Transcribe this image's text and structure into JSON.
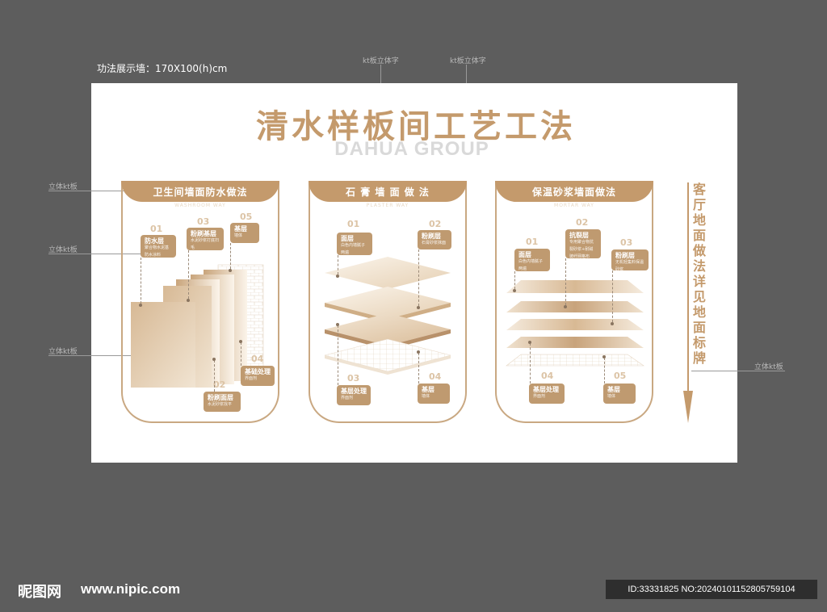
{
  "spec_label": "功法展示墙：170X100(h)cm",
  "callouts": {
    "top_left": "kt板立体字",
    "top_right": "kt板立体字",
    "left_1": "立体kt板",
    "left_2": "立体kt板",
    "left_3": "立体kt板",
    "right_1": "立体kt板"
  },
  "board": {
    "title": "清水样板间工艺工法",
    "brand": "DAHUA GROUP"
  },
  "panels": [
    {
      "title": "卫生间墙面防水做法",
      "subtitle": "WASHROOM WAY",
      "steps": [
        {
          "num": "01",
          "title": "防水层",
          "desc": "聚合物水泥基防水涂料"
        },
        {
          "num": "03",
          "title": "粉刷基层",
          "desc": "水泥砂浆打底扫毛"
        },
        {
          "num": "05",
          "title": "基层",
          "desc": "墙体"
        },
        {
          "num": "04",
          "title": "基础处理",
          "desc": "界面剂"
        },
        {
          "num": "02",
          "title": "粉刷面层",
          "desc": "水泥砂浆找平"
        }
      ]
    },
    {
      "title": "石 膏 墙 面 做 法",
      "subtitle": "PLASTER WAY",
      "steps": [
        {
          "num": "01",
          "title": "面层",
          "desc": "白色内墙腻子两遍"
        },
        {
          "num": "02",
          "title": "粉刷层",
          "desc": "石膏砂浆抹面"
        },
        {
          "num": "03",
          "title": "基层处理",
          "desc": "界面剂"
        },
        {
          "num": "04",
          "title": "基层",
          "desc": "墙体"
        }
      ]
    },
    {
      "title": "保温砂浆墙面做法",
      "subtitle": "MORTAR WAY",
      "steps": [
        {
          "num": "01",
          "title": "面层",
          "desc": "白色内墙腻子两遍"
        },
        {
          "num": "02",
          "title": "抗裂层",
          "desc": "专用聚合物抗裂砂浆+耐碱玻纤网格布"
        },
        {
          "num": "03",
          "title": "粉刷层",
          "desc": "无机轻集料保温砂浆"
        },
        {
          "num": "04",
          "title": "基层处理",
          "desc": "界面剂"
        },
        {
          "num": "05",
          "title": "基层",
          "desc": "墙体"
        }
      ]
    }
  ],
  "side_note": "客厅地面做法详见地面标牌",
  "footer": {
    "logo": "昵图网",
    "site": "www.nipic.com",
    "id": "ID:33331825 NO:20240101152805759104"
  },
  "colors": {
    "accent": "#c49a6c",
    "tag": "#bf9a70",
    "background": "#5d5d5d",
    "board": "#ffffff"
  }
}
